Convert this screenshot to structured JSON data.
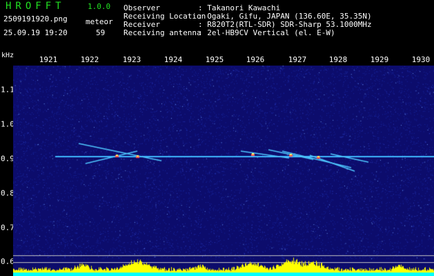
{
  "app": {
    "title": "HROFFT",
    "version": "1.0.0"
  },
  "file": {
    "name": "2509191920.png",
    "datetime": "25.09.19 19:20"
  },
  "meteor": {
    "label": "meteor",
    "count": "59"
  },
  "info": [
    {
      "label": "Observer",
      "value": ": Takanori Kawachi"
    },
    {
      "label": "Receiving Location",
      "value": ": Ogaki, Gifu, JAPAN (136.60E, 35.35N)"
    },
    {
      "label": "Receiver",
      "value": ": R820T2(RTL-SDR) SDR-Sharp 53.1000MHz"
    },
    {
      "label": "Receiving antenna",
      "value": ": 2el-HB9CV Vertical (el. E-W)"
    }
  ],
  "spectrogram": {
    "y_unit": "kHz",
    "x_ticks": [
      "1921",
      "1922",
      "1923",
      "1924",
      "1925",
      "1926",
      "1927",
      "1928",
      "1929",
      "1930"
    ],
    "y_ticks": [
      "1.1",
      "1.0",
      "0.9",
      "0.8",
      "0.7",
      "0.6"
    ],
    "colors": {
      "background": "#0c0c6c",
      "carrier": "#3fb8ff",
      "histogram": "#ffff00",
      "baseline": "#00ffff"
    }
  }
}
